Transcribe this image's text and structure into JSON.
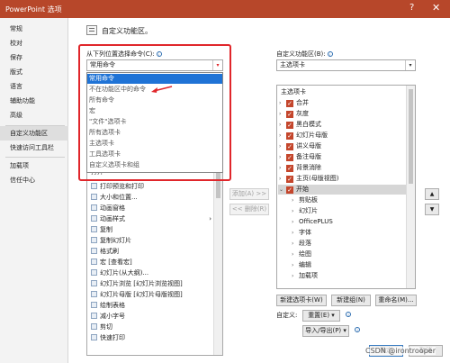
{
  "window": {
    "title": "PowerPoint 选项",
    "help": "?",
    "close": "✕"
  },
  "sidebar": {
    "items": [
      {
        "label": "常规"
      },
      {
        "label": "校对"
      },
      {
        "label": "保存"
      },
      {
        "label": "版式"
      },
      {
        "label": "语言"
      },
      {
        "label": "辅助功能"
      },
      {
        "label": "高级"
      },
      {
        "label": "自定义功能区"
      },
      {
        "label": "快速访问工具栏"
      },
      {
        "label": "加载项"
      },
      {
        "label": "信任中心"
      }
    ]
  },
  "main": {
    "heading": "自定义功能区。",
    "choose_label": "从下列位置选择命令(C):",
    "choose_value": "常用命令",
    "dropdown_options": [
      {
        "label": "常用命令"
      },
      {
        "label": "不在功能区中的命令"
      },
      {
        "label": "所有命令"
      },
      {
        "label": "宏"
      },
      {
        "label": "\"文件\"选项卡"
      },
      {
        "label": "所有选项卡"
      },
      {
        "label": "主选项卡"
      },
      {
        "label": "工具选项卡"
      },
      {
        "label": "自定义选项卡和组"
      }
    ],
    "commands_partial": "打开",
    "commands": [
      {
        "label": "打印预览和打印",
        "arrow": ""
      },
      {
        "label": "大小和位置...",
        "arrow": ""
      },
      {
        "label": "动画窗格",
        "arrow": ""
      },
      {
        "label": "动画样式",
        "arrow": "›"
      },
      {
        "label": "复制",
        "arrow": ""
      },
      {
        "label": "复制幻灯片",
        "arrow": ""
      },
      {
        "label": "格式刷",
        "arrow": ""
      },
      {
        "label": "宏 [查看宏]",
        "arrow": ""
      },
      {
        "label": "幻灯片(从大纲)...",
        "arrow": ""
      },
      {
        "label": "幻灯片浏览 [幻灯片浏览视图]",
        "arrow": ""
      },
      {
        "label": "幻灯片母版 [幻灯片母版视图]",
        "arrow": ""
      },
      {
        "label": "绘制表格",
        "arrow": ""
      },
      {
        "label": "减小字号",
        "arrow": ""
      },
      {
        "label": "剪切",
        "arrow": ""
      },
      {
        "label": "快速打印",
        "arrow": ""
      }
    ],
    "add_button": "添加(A) >>",
    "remove_button": "<< 删除(R)"
  },
  "ribbon": {
    "label": "自定义功能区(B):",
    "select_value": "主选项卡",
    "tree_header": "主选项卡",
    "tabs": [
      {
        "label": "合并"
      },
      {
        "label": "灰度"
      },
      {
        "label": "黑白模式"
      },
      {
        "label": "幻灯片母版"
      },
      {
        "label": "讲义母版"
      },
      {
        "label": "备注母版"
      },
      {
        "label": "背景消除"
      },
      {
        "label": "主页(母版视图)"
      }
    ],
    "start_tab": "开始",
    "groups": [
      {
        "label": "剪贴板"
      },
      {
        "label": "幻灯片"
      },
      {
        "label": "OfficePLUS"
      },
      {
        "label": "字体"
      },
      {
        "label": "段落"
      },
      {
        "label": "绘图"
      },
      {
        "label": "编辑"
      },
      {
        "label": "加载项"
      }
    ],
    "new_tab_button": "新建选项卡(W)",
    "new_group_button": "新建组(N)",
    "rename_button": "重命名(M)...",
    "customize_label": "自定义:",
    "reset_button": "重置(E) ▾",
    "import_export_button": "导入/导出(P) ▾",
    "ok_button": "确定",
    "cancel_button": "取消",
    "up_arrow": "▲",
    "down_arrow": "▼"
  },
  "watermark": "CSDN @irontrooper",
  "colors": {
    "titlebar": "#b7472a",
    "selection": "#1f73d6",
    "highlight_box": "#e0262b",
    "checkbox": "#c4462c"
  }
}
